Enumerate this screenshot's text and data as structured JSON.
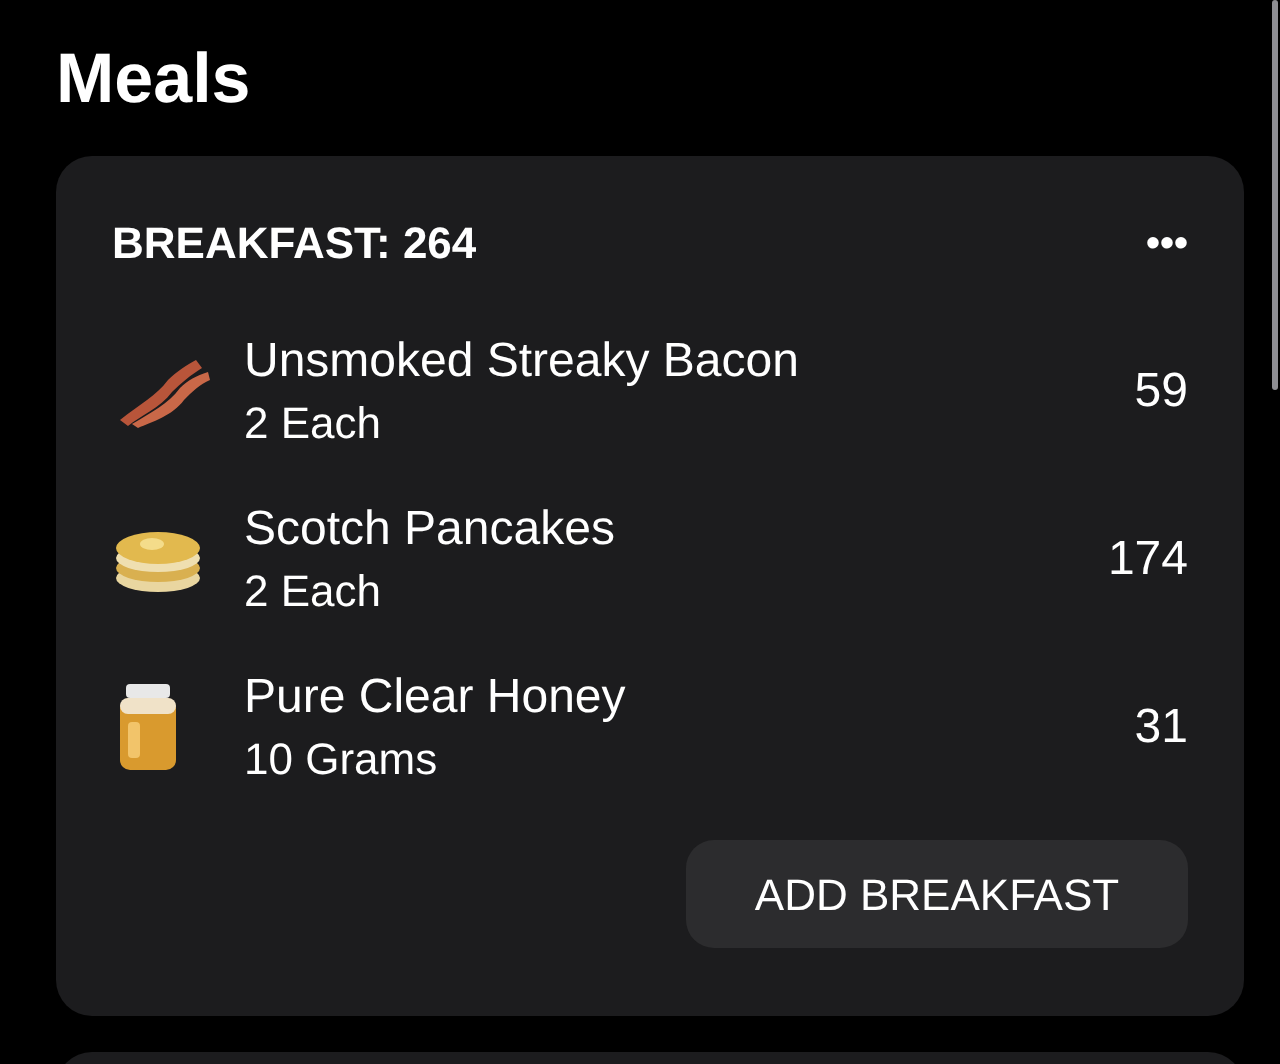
{
  "title": "Meals",
  "meal": {
    "header": "BREAKFAST: 264",
    "menu": "•••",
    "items": [
      {
        "kind": "bacon",
        "name": "Unsmoked Streaky Bacon",
        "amount": "2 Each",
        "calories": "59"
      },
      {
        "kind": "pancakes",
        "name": "Scotch Pancakes",
        "amount": "2 Each",
        "calories": "174"
      },
      {
        "kind": "honey",
        "name": "Pure Clear Honey",
        "amount": "10 Grams",
        "calories": "31"
      }
    ],
    "button": "ADD BREAKFAST"
  }
}
